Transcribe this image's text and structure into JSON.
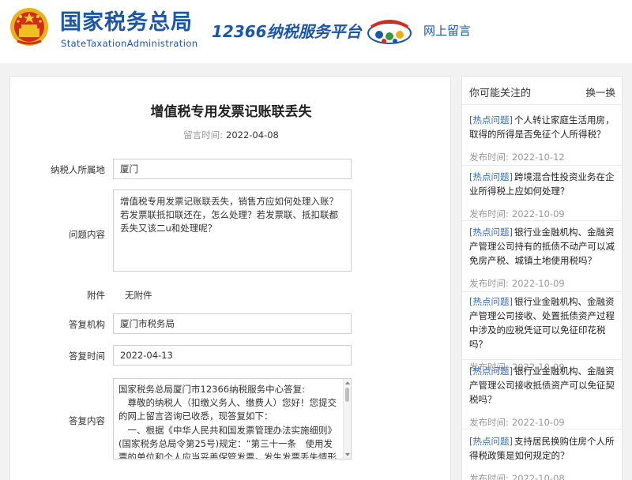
{
  "header": {
    "title": "国家税务总局",
    "subtitle": "StateTaxationAdministration",
    "platform": "12366纳税服务平台",
    "nav_link": "网上留言"
  },
  "message": {
    "title": "增值税专用发票记账联丢失",
    "date_label": "留言时间:",
    "date": "2022-04-08",
    "region_label": "纳税人所属地",
    "region": "厦门",
    "question_label": "问题内容",
    "question": "增值税专用发票记账联丢失，销售方应如何处理入账？若发票联抵扣联还在，怎么处理？若发票联、抵扣联都丢失又该二u和处理呢？",
    "attachment_label": "附件",
    "attachment": "无附件",
    "agency_label": "答复机构",
    "agency": "厦门市税务局",
    "reply_time_label": "答复时间",
    "reply_time": "2022-04-13",
    "reply_label": "答复内容",
    "reply_lines": [
      "国家税务总局厦门市12366纳税服务中心答复:",
      "　尊敬的纳税人（扣缴义务人、缴费人）您好！您提交的网上留言咨询已收悉，现答复如下：",
      "　一、根据《中华人民共和国发票管理办法实施细则》(国家税务总局令第25号)规定：“第三十一条　使用发票的单位和个人应当妥善保管发票。发生发票丢失情形时，应当"
    ]
  },
  "sidebar": {
    "title": "你可能关注的",
    "refresh": "换一换",
    "items": [
      {
        "tag": "[热点问题]",
        "title": "个人转让家庭生活用房，取得的所得是否免征个人所得税？",
        "date_label": "发布时间:",
        "date": "2022-10-12"
      },
      {
        "tag": "[热点问题]",
        "title": "跨境混合性投资业务在企业所得税上应如何处理？",
        "date_label": "发布时间:",
        "date": "2022-10-09"
      },
      {
        "tag": "[热点问题]",
        "title": "银行业金融机构、金融资产管理公司持有的抵债不动产可以减免房产税、城镇土地使用税吗？",
        "date_label": "发布时间:",
        "date": "2022-10-09"
      },
      {
        "tag": "[热点问题]",
        "title": "银行业金融机构、金融资产管理公司接收、处置抵债资产过程中涉及的应税凭证可以免征印花税吗？",
        "date_label": "发布时间:",
        "date": "2022-10-09"
      },
      {
        "tag": "[热点问题]",
        "title": "银行业金融机构、金融资产管理公司接收抵债资产可以免征契税吗？",
        "date_label": "发布时间:",
        "date": "2022-10-09"
      },
      {
        "tag": "[热点问题]",
        "title": "支持居民换购住房个人所得税政策是如何规定的？",
        "date_label": "发布时间:",
        "date": "2022-10-08"
      }
    ]
  },
  "colors": {
    "brand_blue": "#1c56a6",
    "tag_blue": "#2f6fc3",
    "emblem_red": "#d42c1c",
    "emblem_gold": "#f0c020"
  },
  "icons": {
    "emblem": "national-emblem-icon",
    "platform": "platform-logo-icon",
    "scroll_up": "scroll-up-icon",
    "scroll_down": "scroll-down-icon"
  }
}
